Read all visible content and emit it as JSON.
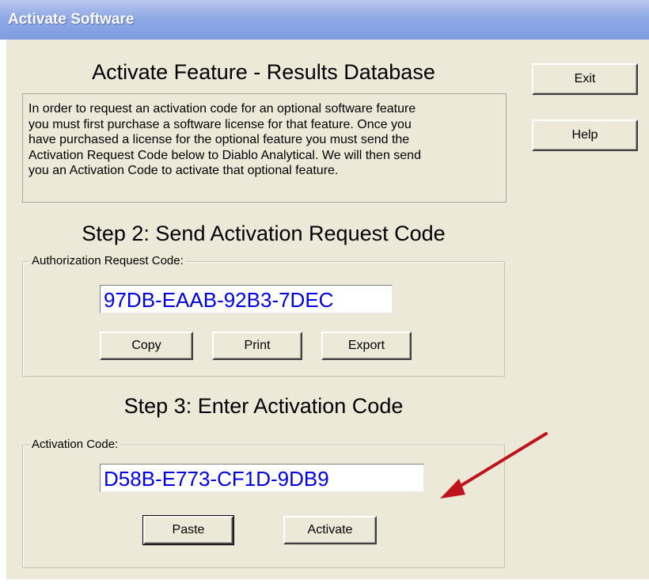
{
  "window": {
    "title": "Activate Software"
  },
  "header": {
    "title": "Activate Feature - Results Database"
  },
  "info": {
    "lines": [
      "In order to request an activation code for an optional software feature",
      "you must first purchase a software license for that feature.  Once you",
      "have purchased a license for the optional feature you must send the",
      "Activation Request Code below to Diablo Analytical.  We will then send",
      "you an Activation Code to activate that optional feature."
    ]
  },
  "side_buttons": {
    "exit": "Exit",
    "help": "Help"
  },
  "step2": {
    "title": "Step 2: Send Activation Request Code",
    "group_label": "Authorization Request Code:",
    "code": "97DB-EAAB-92B3-7DEC",
    "buttons": {
      "copy": "Copy",
      "print": "Print",
      "export": "Export"
    }
  },
  "step3": {
    "title": "Step 3: Enter Activation Code",
    "group_label": "Activation Code:",
    "code": "D58B-E773-CF1D-9DB9",
    "buttons": {
      "paste": "Paste",
      "activate": "Activate"
    }
  },
  "colors": {
    "code_text": "#0000e6",
    "arrow": "#c0141c",
    "dialog_bg": "#ece9d8"
  }
}
